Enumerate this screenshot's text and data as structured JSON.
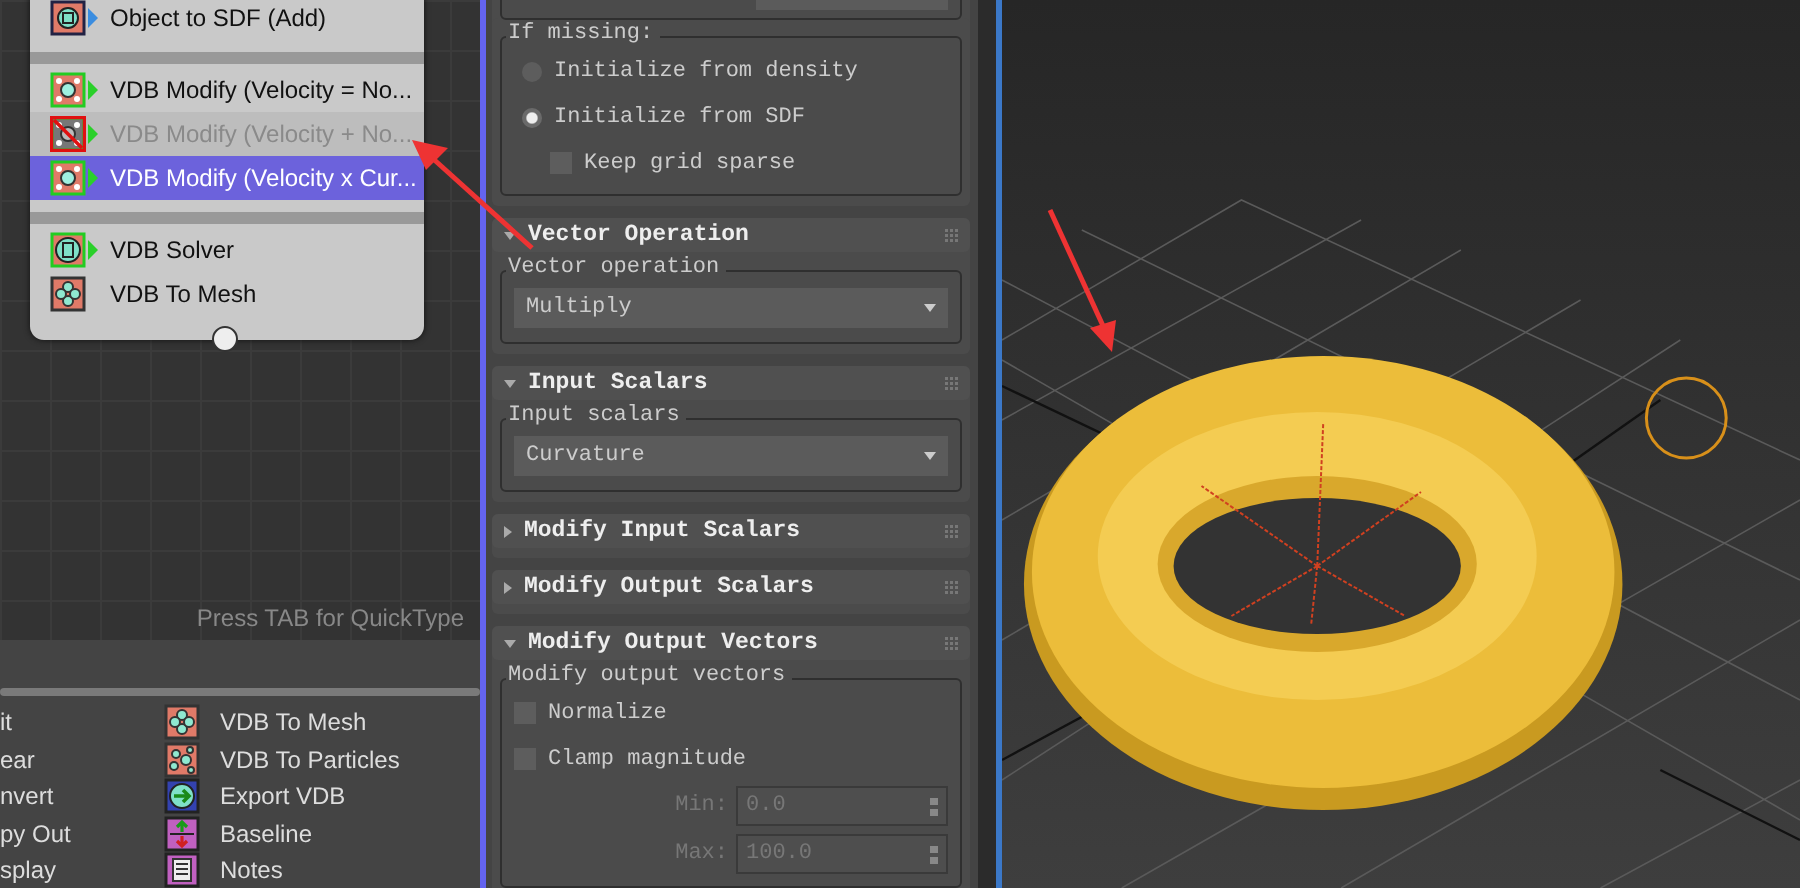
{
  "flow_node": {
    "groups": [
      [
        {
          "label": "Object to SDF (Add)",
          "kind": "sdf",
          "disabled": false,
          "selected": false
        }
      ],
      [
        {
          "label": "VDB Modify (Velocity = No...",
          "kind": "modify",
          "disabled": false,
          "selected": false
        },
        {
          "label": "VDB Modify (Velocity + No...",
          "kind": "modify",
          "disabled": true,
          "selected": false
        },
        {
          "label": "VDB Modify (Velocity x Cur...",
          "kind": "modify",
          "disabled": false,
          "selected": true
        }
      ],
      [
        {
          "label": "VDB Solver",
          "kind": "solver",
          "disabled": false,
          "selected": false
        },
        {
          "label": "VDB To Mesh",
          "kind": "to_mesh",
          "disabled": false,
          "selected": false
        }
      ]
    ]
  },
  "editor_hint": "Press TAB for QuickType",
  "operator_depot": {
    "columns": [
      [
        {
          "label": "it"
        },
        {
          "label": "ear"
        },
        {
          "label": "nvert"
        },
        {
          "label": "py Out"
        },
        {
          "label": "splay"
        }
      ],
      [
        {
          "label": "VDB To Mesh",
          "kind": "to_mesh"
        },
        {
          "label": "VDB To Particles",
          "kind": "particles"
        },
        {
          "label": "Export VDB",
          "kind": "export"
        },
        {
          "label": "Baseline",
          "kind": "baseline"
        },
        {
          "label": "Notes",
          "kind": "notes"
        }
      ]
    ]
  },
  "rollouts": [
    {
      "groups": [
        {
          "controls": [
            {
              "kind": "field"
            }
          ]
        }
      ]
    },
    {
      "groups": [
        {
          "legend": "If missing:",
          "controls": [
            {
              "kind": "radio",
              "label": "Initialize from density",
              "selected": false
            },
            {
              "kind": "radio",
              "label": "Initialize from SDF",
              "selected": true
            },
            {
              "kind": "checkbox",
              "label": "Keep grid sparse",
              "checked": false,
              "indent": true
            }
          ]
        }
      ]
    },
    {
      "title": "Vector Operation",
      "expanded": true,
      "groups": [
        {
          "legend": "Vector operation",
          "controls": [
            {
              "kind": "dropdown",
              "value": "Multiply"
            }
          ]
        }
      ]
    },
    {
      "title": "Input Scalars",
      "expanded": true,
      "groups": [
        {
          "legend": "Input scalars",
          "controls": [
            {
              "kind": "dropdown",
              "value": "Curvature"
            }
          ]
        }
      ]
    },
    {
      "title": "Modify Input Scalars",
      "expanded": false
    },
    {
      "title": "Modify Output Scalars",
      "expanded": false
    },
    {
      "title": "Modify Output Vectors",
      "expanded": true,
      "groups": [
        {
          "legend": "Modify output vectors",
          "controls": [
            {
              "kind": "checkbox",
              "label": "Normalize",
              "checked": false
            },
            {
              "kind": "checkbox",
              "label": "Clamp magnitude",
              "checked": false
            },
            {
              "kind": "spinner",
              "label": "Min:",
              "value": "0.0",
              "disabled": true
            },
            {
              "kind": "spinner",
              "label": "Max:",
              "value": "100.0",
              "disabled": true
            }
          ]
        }
      ]
    }
  ]
}
